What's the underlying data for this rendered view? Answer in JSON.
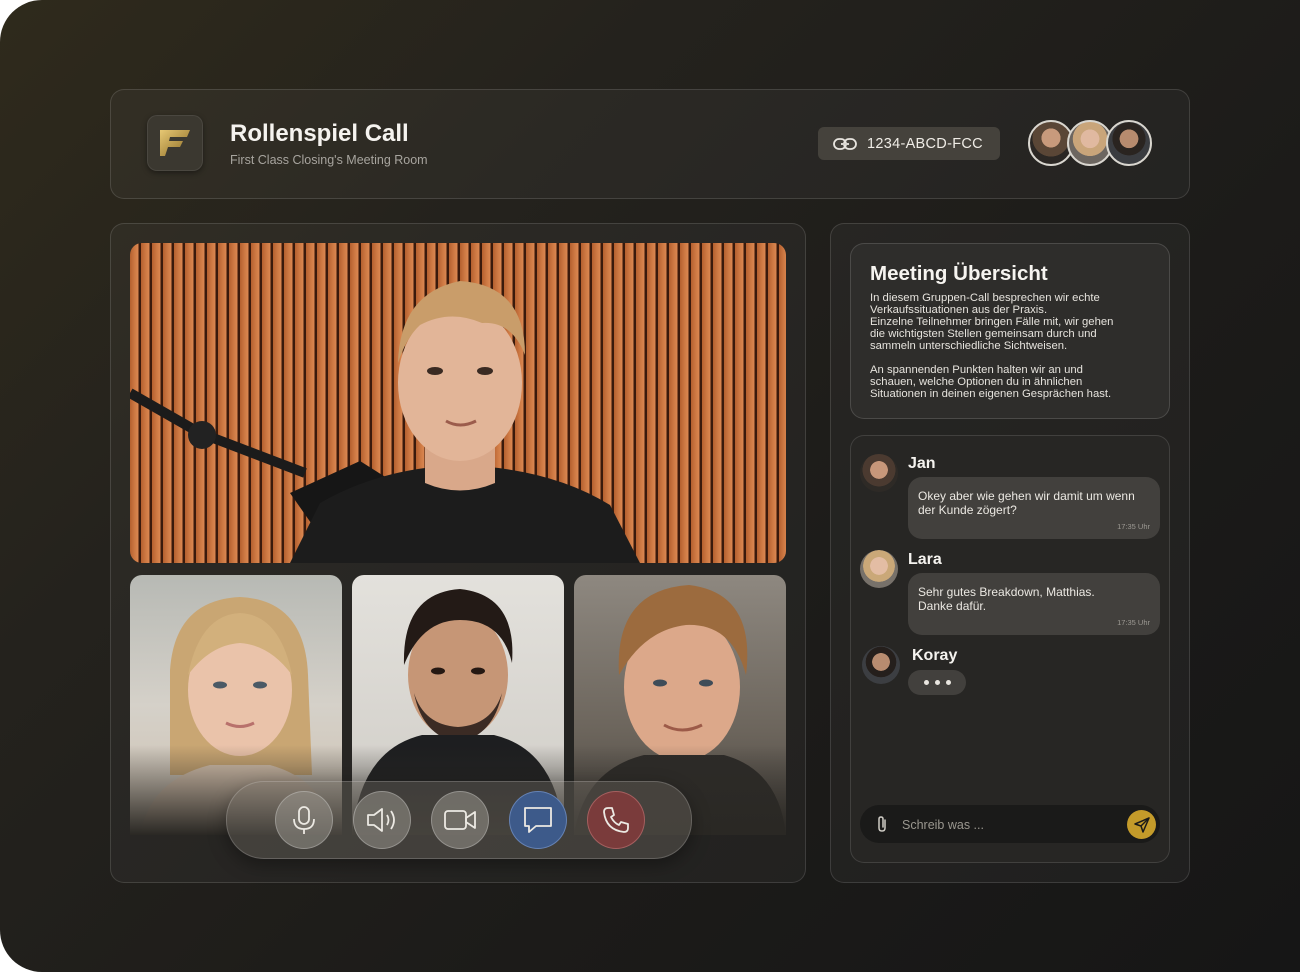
{
  "header": {
    "title": "Rollenspiel Call",
    "subtitle": "First Class Closing's Meeting Room",
    "room_code": "1234-ABCD-FCC",
    "link_icon": "link-icon",
    "logo_icon": "brand-f-logo"
  },
  "participants": [
    "Jan",
    "Lara",
    "Koray"
  ],
  "controls": [
    {
      "name": "microphone-button",
      "icon": "microphone-icon"
    },
    {
      "name": "speaker-button",
      "icon": "speaker-icon"
    },
    {
      "name": "camera-button",
      "icon": "video-camera-icon"
    },
    {
      "name": "chat-button",
      "icon": "chat-bubble-icon"
    },
    {
      "name": "end-call-button",
      "icon": "phone-icon"
    }
  ],
  "overview": {
    "title": "Meeting Übersicht",
    "paragraph1": "In diesem Gruppen-Call besprechen wir echte\nVerkaufssituationen aus der Praxis.\nEinzelne Teilnehmer bringen Fälle mit, wir gehen\ndie wichtigsten Stellen gemeinsam durch und\nsammeln unterschiedliche Sichtweisen.",
    "paragraph2": "An spannenden Punkten halten wir an und\nschauen, welche Optionen du in ähnlichen\nSituationen in deinen eigenen Gesprächen hast."
  },
  "chat": {
    "messages": [
      {
        "name": "Jan",
        "text": "Okey aber wie gehen wir damit um wenn\nder Kunde zögert?",
        "time": "17:35 Uhr"
      },
      {
        "name": "Lara",
        "text": "Sehr gutes Breakdown, Matthias.\nDanke dafür.",
        "time": "17:35 Uhr"
      },
      {
        "name": "Koray",
        "typing": true
      }
    ],
    "input_placeholder": "Schreib was ...",
    "colors": {
      "send": "#c49b2a",
      "chat_button": "#3d5a8a",
      "end_call": "#7a3b3b"
    }
  }
}
